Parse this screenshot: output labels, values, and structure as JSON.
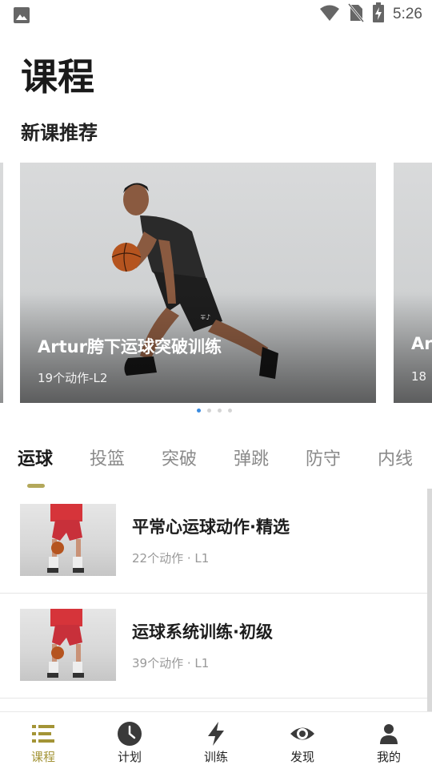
{
  "status_bar": {
    "time": "5:26",
    "icons": [
      "image-icon",
      "wifi-icon",
      "no-sim-icon",
      "battery-charging-icon"
    ]
  },
  "page": {
    "title": "课程",
    "section_title": "新课推荐"
  },
  "carousel": {
    "cards": [
      {
        "title": "Artur胯下运球突破训练",
        "subtitle": "19个动作-L2"
      },
      {
        "title": "Art",
        "subtitle": "18"
      }
    ],
    "page_count": 4,
    "active_page": 1
  },
  "tabs": {
    "items": [
      "运球",
      "投篮",
      "突破",
      "弹跳",
      "防守",
      "内线"
    ],
    "active": "运球"
  },
  "course_list": [
    {
      "title": "平常心运球动作·精选",
      "subtitle": "22个动作 · L1"
    },
    {
      "title": "运球系统训练·初级",
      "subtitle": "39个动作 · L1"
    }
  ],
  "bottom_nav": {
    "items": [
      {
        "label": "课程",
        "icon": "list-icon"
      },
      {
        "label": "计划",
        "icon": "clock-icon"
      },
      {
        "label": "训练",
        "icon": "lightning-icon"
      },
      {
        "label": "发现",
        "icon": "eye-icon"
      },
      {
        "label": "我的",
        "icon": "person-icon"
      }
    ],
    "active": "课程"
  },
  "colors": {
    "accent": "#a39436",
    "indicator": "#b3a85a",
    "dot_active": "#3a8be0"
  }
}
